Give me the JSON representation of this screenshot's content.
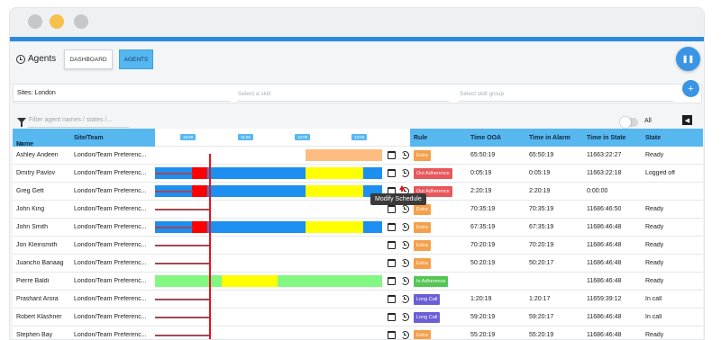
{
  "header": {
    "title": "Agents",
    "tabs": [
      {
        "label": "DASHBOARD",
        "active": false
      },
      {
        "label": "AGENTS",
        "active": true
      }
    ],
    "pause_icon": "pause-icon"
  },
  "filters": {
    "sites_value": "Sites: London",
    "skill_placeholder": "Select a skill",
    "skill_group_placeholder": "Select skill group",
    "agent_filter_placeholder": "Filter agent names / states /...",
    "all_toggle_label": "All",
    "all_toggle_on": false
  },
  "columns": {
    "name": "Name",
    "site_team": "Site/Team",
    "rule": "Rule",
    "time_ooa": "Time OOA",
    "time_in_alarm": "Time in Alarm",
    "time_in_state": "Time in State",
    "state": "State"
  },
  "timeline": {
    "ticks": [
      "10:00",
      "11:00",
      "12:00",
      "13:00"
    ]
  },
  "colors": {
    "accent": "#57b8f0",
    "extra": "#f5a04a",
    "out_adherence": "#e8575c",
    "in_adherence": "#54c654",
    "long_call": "#6a5fd6",
    "timeline_blue": "#1d8ff0",
    "timeline_yellow": "#ffff00",
    "timeline_red": "#ff0000",
    "timeline_orange": "#ffbc80",
    "timeline_green": "#82f782",
    "now_line": "#e8121e"
  },
  "rows": [
    {
      "name": "Ashley Andeen",
      "site": "London/Team Preferenc...",
      "rule": "Extra",
      "rule_type": "extra",
      "ooa": "65:50:19",
      "alarm": "65:50:19",
      "state_time": "11663:22:27",
      "state": "Ready",
      "timeline": "orange"
    },
    {
      "name": "Dmitry Pavlov",
      "site": "London/Team Preferenc...",
      "rule": "Out Adherence",
      "rule_type": "out",
      "ooa": "0:05:19",
      "alarm": "0:05:19",
      "state_time": "11663:22:18",
      "state": "Logged off",
      "timeline": "full"
    },
    {
      "name": "Greg Gett",
      "site": "London/Team Preferenc...",
      "rule": "Out Adherence",
      "rule_type": "out",
      "ooa": "2:20:19",
      "alarm": "2:20:19",
      "state_time": "0:00:00",
      "state": "",
      "timeline": "full"
    },
    {
      "name": "John King",
      "site": "London/Team Preferenc...",
      "rule": "Extra",
      "rule_type": "extra",
      "ooa": "70:35:19",
      "alarm": "70:35:19",
      "state_time": "11686:46:50",
      "state": "Ready",
      "timeline": "line"
    },
    {
      "name": "John Smith",
      "site": "London/Team Preferenc...",
      "rule": "Extra",
      "rule_type": "extra",
      "ooa": "67:35:19",
      "alarm": "67:35:19",
      "state_time": "11686:46:48",
      "state": "Ready",
      "timeline": "full"
    },
    {
      "name": "Jon Kleinsmith",
      "site": "London/Team Preferenc...",
      "rule": "Extra",
      "rule_type": "extra",
      "ooa": "70:20:19",
      "alarm": "70:20:19",
      "state_time": "11686:46:48",
      "state": "Ready",
      "timeline": "line"
    },
    {
      "name": "Juancho Banaag",
      "site": "London/Team Preferenc...",
      "rule": "Extra",
      "rule_type": "extra",
      "ooa": "50:20:19",
      "alarm": "50:20:17",
      "state_time": "11686:46:48",
      "state": "Ready",
      "timeline": "line"
    },
    {
      "name": "Pierre Baldi",
      "site": "London/Team Preferenc...",
      "rule": "In Adherence",
      "rule_type": "in",
      "ooa": "",
      "alarm": "",
      "state_time": "11686:46:48",
      "state": "Ready",
      "timeline": "green"
    },
    {
      "name": "Prashant Arora",
      "site": "London/Team Preferenc...",
      "rule": "Long Call",
      "rule_type": "long",
      "ooa": "1:20:19",
      "alarm": "1:20:17",
      "state_time": "11659:39:12",
      "state": "In call",
      "timeline": "line"
    },
    {
      "name": "Robert Klashner",
      "site": "London/Team Preferenc...",
      "rule": "Long Call",
      "rule_type": "long",
      "ooa": "59:20:19",
      "alarm": "59:20:17",
      "state_time": "11686:46:48",
      "state": "In call",
      "timeline": "line"
    },
    {
      "name": "Stephen Bay",
      "site": "London/Team Preferenc...",
      "rule": "Extra",
      "rule_type": "extra",
      "ooa": "55:20:19",
      "alarm": "55:20:19",
      "state_time": "11686:46:48",
      "state": "Ready",
      "timeline": "line"
    }
  ],
  "tooltip": "Modify Schedule"
}
